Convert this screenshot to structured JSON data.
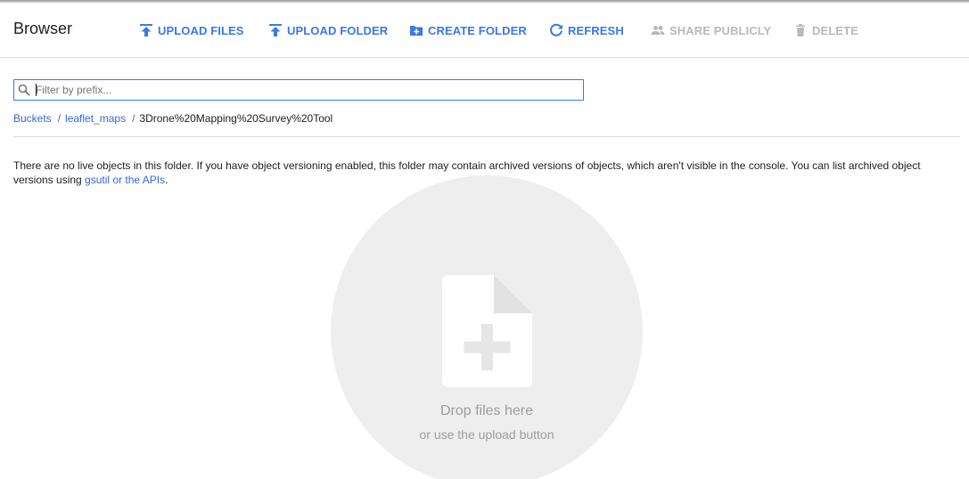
{
  "header": {
    "title": "Browser",
    "actions": [
      {
        "label": "UPLOAD FILES",
        "icon": "upload-icon",
        "enabled": true
      },
      {
        "label": "UPLOAD FOLDER",
        "icon": "upload-icon",
        "enabled": true
      },
      {
        "label": "CREATE FOLDER",
        "icon": "create-folder-icon",
        "enabled": true
      },
      {
        "label": "REFRESH",
        "icon": "refresh-icon",
        "enabled": true
      },
      {
        "label": "SHARE PUBLICLY",
        "icon": "people-icon",
        "enabled": false
      },
      {
        "label": "DELETE",
        "icon": "trash-icon",
        "enabled": false
      }
    ]
  },
  "filter": {
    "value": "",
    "placeholder": "Filter by prefix..."
  },
  "breadcrumb": {
    "items": [
      {
        "label": "Buckets",
        "link": true
      },
      {
        "label": "leaflet_maps",
        "link": true
      },
      {
        "label": "3Drone%20Mapping%20Survey%20Tool",
        "link": false
      }
    ],
    "separator": "/"
  },
  "notice": {
    "text": "There are no live objects in this folder. If you have object versioning enabled, this folder may contain archived versions of objects, which aren't visible in the console. You can list archived object versions using ",
    "link_text": "gsutil or the APIs",
    "suffix": "."
  },
  "dropzone": {
    "title": "Drop files here",
    "subtitle": "or use the upload button",
    "icon": "add-file-icon"
  },
  "colors": {
    "accent": "#3b78e7",
    "link": "#3367d6",
    "disabled": "#b9b9b9",
    "dropzone_bg": "#eeeeee"
  }
}
